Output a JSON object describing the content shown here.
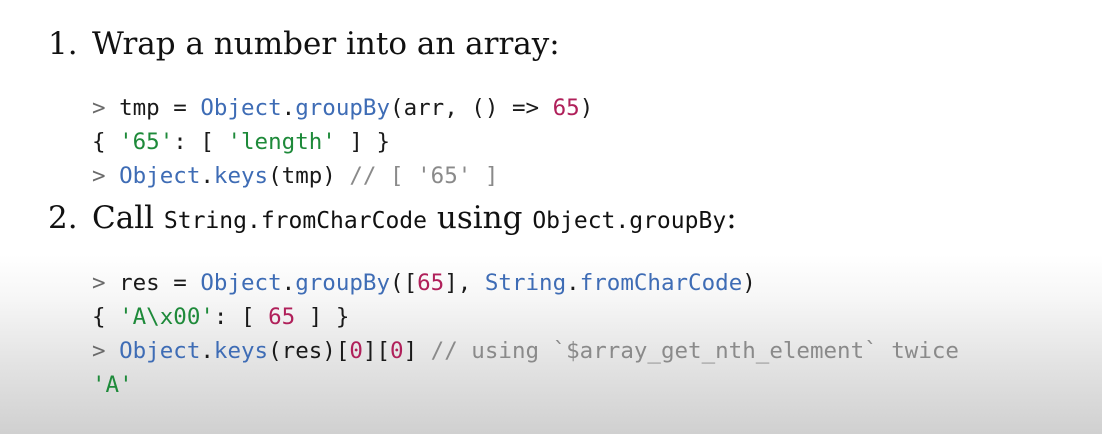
{
  "item1": {
    "number": "1.",
    "heading": "Wrap a number into an array:",
    "code": [
      [
        {
          "t": "> ",
          "c": "prompt"
        },
        {
          "t": "tmp = ",
          "c": "plain"
        },
        {
          "t": "Object",
          "c": "fn"
        },
        {
          "t": ".",
          "c": "plain"
        },
        {
          "t": "groupBy",
          "c": "fn"
        },
        {
          "t": "(arr, () => ",
          "c": "plain"
        },
        {
          "t": "65",
          "c": "num-lit"
        },
        {
          "t": ")",
          "c": "plain"
        }
      ],
      [
        {
          "t": "{ ",
          "c": "plain"
        },
        {
          "t": "'65'",
          "c": "str"
        },
        {
          "t": ": [ ",
          "c": "plain"
        },
        {
          "t": "'length'",
          "c": "str"
        },
        {
          "t": " ] }",
          "c": "plain"
        }
      ],
      [
        {
          "t": "> ",
          "c": "prompt"
        },
        {
          "t": "Object",
          "c": "fn"
        },
        {
          "t": ".",
          "c": "plain"
        },
        {
          "t": "keys",
          "c": "fn"
        },
        {
          "t": "(tmp) ",
          "c": "plain"
        },
        {
          "t": "// [ '65' ]",
          "c": "comment"
        }
      ]
    ]
  },
  "item2": {
    "number": "2.",
    "heading_pre": "Call ",
    "heading_code1": "String.fromCharCode",
    "heading_mid": " using ",
    "heading_code2": "Object.groupBy",
    "heading_post": ":",
    "code": [
      [
        {
          "t": "> ",
          "c": "prompt"
        },
        {
          "t": "res = ",
          "c": "plain"
        },
        {
          "t": "Object",
          "c": "fn"
        },
        {
          "t": ".",
          "c": "plain"
        },
        {
          "t": "groupBy",
          "c": "fn"
        },
        {
          "t": "([",
          "c": "plain"
        },
        {
          "t": "65",
          "c": "num-lit"
        },
        {
          "t": "], ",
          "c": "plain"
        },
        {
          "t": "String",
          "c": "fn"
        },
        {
          "t": ".",
          "c": "plain"
        },
        {
          "t": "fromCharCode",
          "c": "fn"
        },
        {
          "t": ")",
          "c": "plain"
        }
      ],
      [
        {
          "t": "{ ",
          "c": "plain"
        },
        {
          "t": "'A\\x00'",
          "c": "str"
        },
        {
          "t": ": [ ",
          "c": "plain"
        },
        {
          "t": "65",
          "c": "num-lit"
        },
        {
          "t": " ] }",
          "c": "plain"
        }
      ],
      [
        {
          "t": "> ",
          "c": "prompt"
        },
        {
          "t": "Object",
          "c": "fn"
        },
        {
          "t": ".",
          "c": "plain"
        },
        {
          "t": "keys",
          "c": "fn"
        },
        {
          "t": "(res)[",
          "c": "plain"
        },
        {
          "t": "0",
          "c": "num-lit"
        },
        {
          "t": "][",
          "c": "plain"
        },
        {
          "t": "0",
          "c": "num-lit"
        },
        {
          "t": "] ",
          "c": "plain"
        },
        {
          "t": "// using `$array_get_nth_element` twice",
          "c": "comment"
        }
      ],
      [
        {
          "t": "'A'",
          "c": "str"
        }
      ]
    ]
  }
}
